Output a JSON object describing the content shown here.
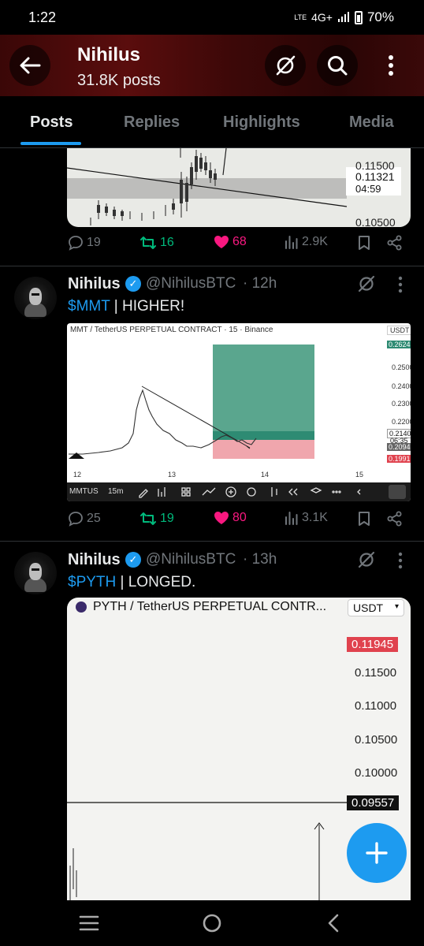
{
  "status_bar": {
    "time": "1:22",
    "network": "4G+",
    "battery": "70%",
    "volte": "LTE"
  },
  "header": {
    "title": "Nihilus",
    "subtitle": "31.8K posts"
  },
  "tabs": [
    {
      "label": "Posts",
      "active": true
    },
    {
      "label": "Replies",
      "active": false
    },
    {
      "label": "Highlights",
      "active": false
    },
    {
      "label": "Media",
      "active": false
    }
  ],
  "post0": {
    "chart": {
      "ticks": [
        "0.11500",
        "0.10500"
      ],
      "price": "0.11321",
      "timer": "04:59"
    },
    "stats": {
      "replies": "19",
      "reposts": "16",
      "likes": "68",
      "views": "2.9K"
    }
  },
  "post1": {
    "name": "Nihilus",
    "handle": "@NihilusBTC",
    "time": "· 12h",
    "cashtag": "$MMT",
    "text": " | HIGHER!",
    "chart": {
      "title": "MMT / TetherUS PERPETUAL CONTRACT · 15 · Binance",
      "currency": "USDT",
      "y_ticks": [
        "0.2500",
        "0.2400",
        "0.2300",
        "0.2200"
      ],
      "target": "0.2624",
      "current": "0.2140",
      "timer": "06:35",
      "entry": "0.2094",
      "stop": "0.1991",
      "x_ticks": [
        "12",
        "13",
        "14",
        "15"
      ],
      "toolbar_symbol": "MMTUS",
      "interval": "15m"
    },
    "stats": {
      "replies": "25",
      "reposts": "19",
      "likes": "80",
      "views": "3.1K"
    }
  },
  "post2": {
    "name": "Nihilus",
    "handle": "@NihilusBTC",
    "time": "· 13h",
    "cashtag": "$PYTH",
    "text": " | LONGED.",
    "chart": {
      "title": "PYTH / TetherUS PERPETUAL CONTR...",
      "currency": "USDT",
      "current": "0.11945",
      "y_ticks": [
        "0.11500",
        "0.11000",
        "0.10500",
        "0.10000"
      ],
      "line_price": "0.09557"
    }
  },
  "colors": {
    "accent": "#1d9bf0",
    "like": "#f91880",
    "repost": "#00ba7c",
    "header_red": "#5a0d0d"
  }
}
